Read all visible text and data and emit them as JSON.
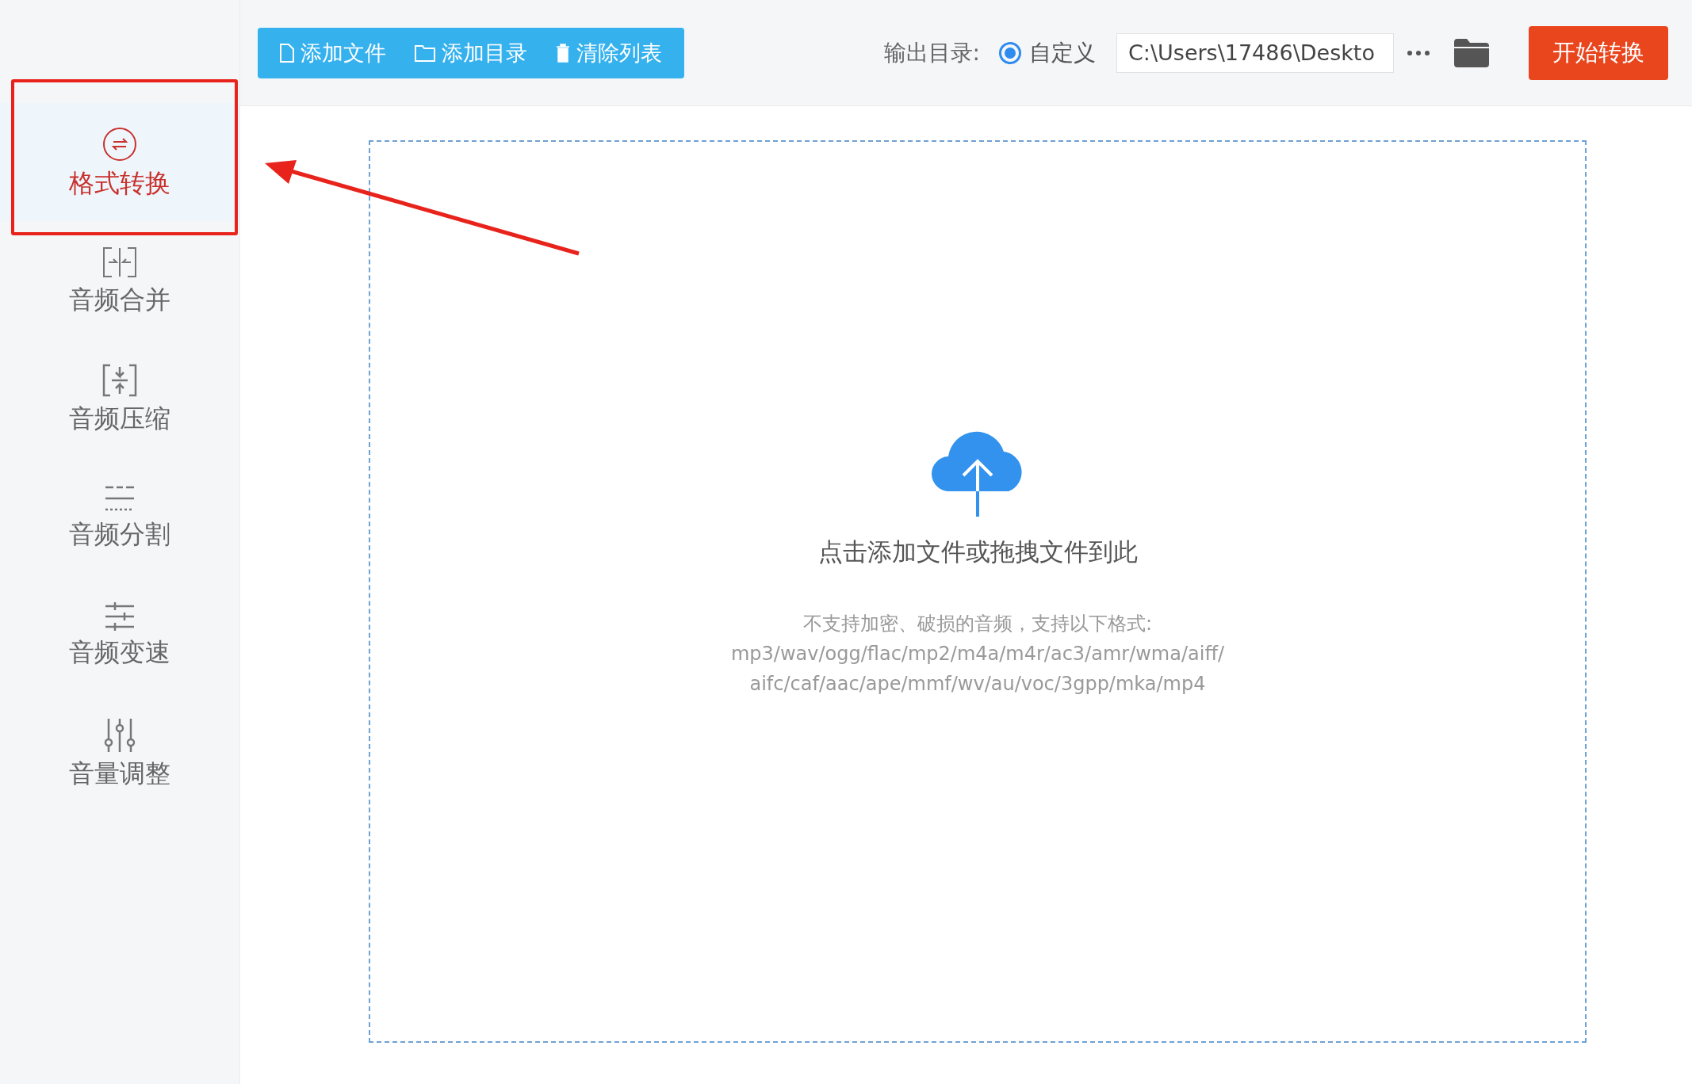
{
  "sidebar": {
    "items": [
      {
        "kind": "convert",
        "label": "格式转换",
        "selected": true
      },
      {
        "kind": "merge",
        "label": "音频合并",
        "selected": false
      },
      {
        "kind": "compress",
        "label": "音频压缩",
        "selected": false
      },
      {
        "kind": "split",
        "label": "音频分割",
        "selected": false
      },
      {
        "kind": "speed",
        "label": "音频变速",
        "selected": false
      },
      {
        "kind": "volume",
        "label": "音量调整",
        "selected": false
      }
    ]
  },
  "toolbar": {
    "buttons": [
      {
        "kind": "file",
        "label": "添加文件"
      },
      {
        "kind": "folder",
        "label": "添加目录"
      },
      {
        "kind": "trash",
        "label": "清除列表"
      }
    ],
    "output_label": "输出目录:",
    "radio": {
      "label": "自定义",
      "selected": true
    },
    "path": "C:\\Users\\17486\\Deskto",
    "start_button": "开始转换"
  },
  "dropzone": {
    "title": "点击添加文件或拖拽文件到此",
    "hint_lines": [
      "不支持加密、破损的音频，支持以下格式:",
      "mp3/wav/ogg/flac/mp2/m4a/m4r/ac3/amr/wma/aiff/",
      "aifc/caf/aac/ape/mmf/wv/au/voc/3gpp/mka/mp4"
    ]
  }
}
